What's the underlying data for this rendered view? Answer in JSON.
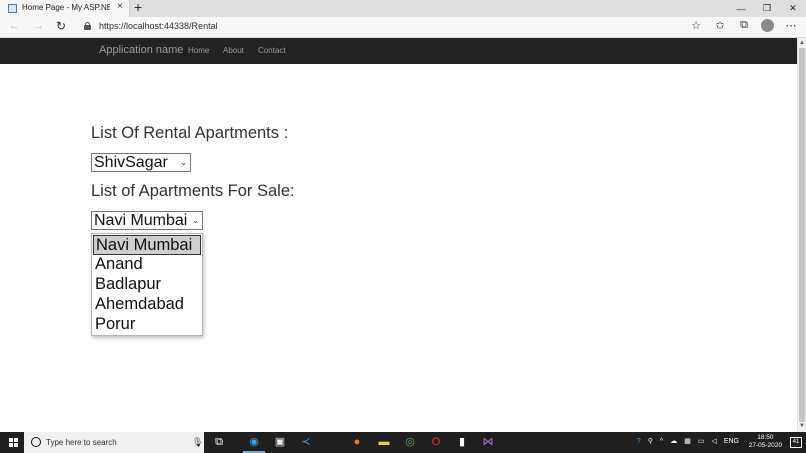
{
  "browser": {
    "tab_title": "Home Page - My ASP.NET Applic",
    "tab_close": "×",
    "new_tab": "+",
    "url": "https://localhost:44338/Rental",
    "window_controls": [
      "—",
      "❐",
      "✕"
    ],
    "icons": [
      "back-arrow-icon",
      "forward-arrow-icon",
      "reload-icon",
      "lock-icon",
      "star-icon",
      "favorites-icon",
      "collections-icon",
      "profile-avatar-icon",
      "more-icon"
    ]
  },
  "navbar": {
    "brand": "Application name",
    "links": [
      "Home",
      "About",
      "Contact"
    ]
  },
  "main": {
    "rental_heading": "List Of Rental Apartments :",
    "rental_select_value": "ShivSagar",
    "sale_heading": "List of Apartments For Sale:",
    "sale_select_value": "Navi Mumbai",
    "sale_options": [
      "Navi Mumbai",
      "Anand",
      "Badlapur",
      "Ahemdabad",
      "Porur"
    ],
    "sale_selected_index": 0
  },
  "taskbar": {
    "search_placeholder": "Type here to search",
    "language": "ENG",
    "time": "18:50",
    "date": "27-05-2020",
    "notification_count": "41",
    "colors": {
      "background": "#1f1f1f",
      "active_indicator": "#7aa8e0"
    }
  },
  "colors": {
    "navbar_bg": "#222222",
    "navbar_text": "#9d9d9d",
    "selected_option_bg": "#cfcfcf"
  }
}
